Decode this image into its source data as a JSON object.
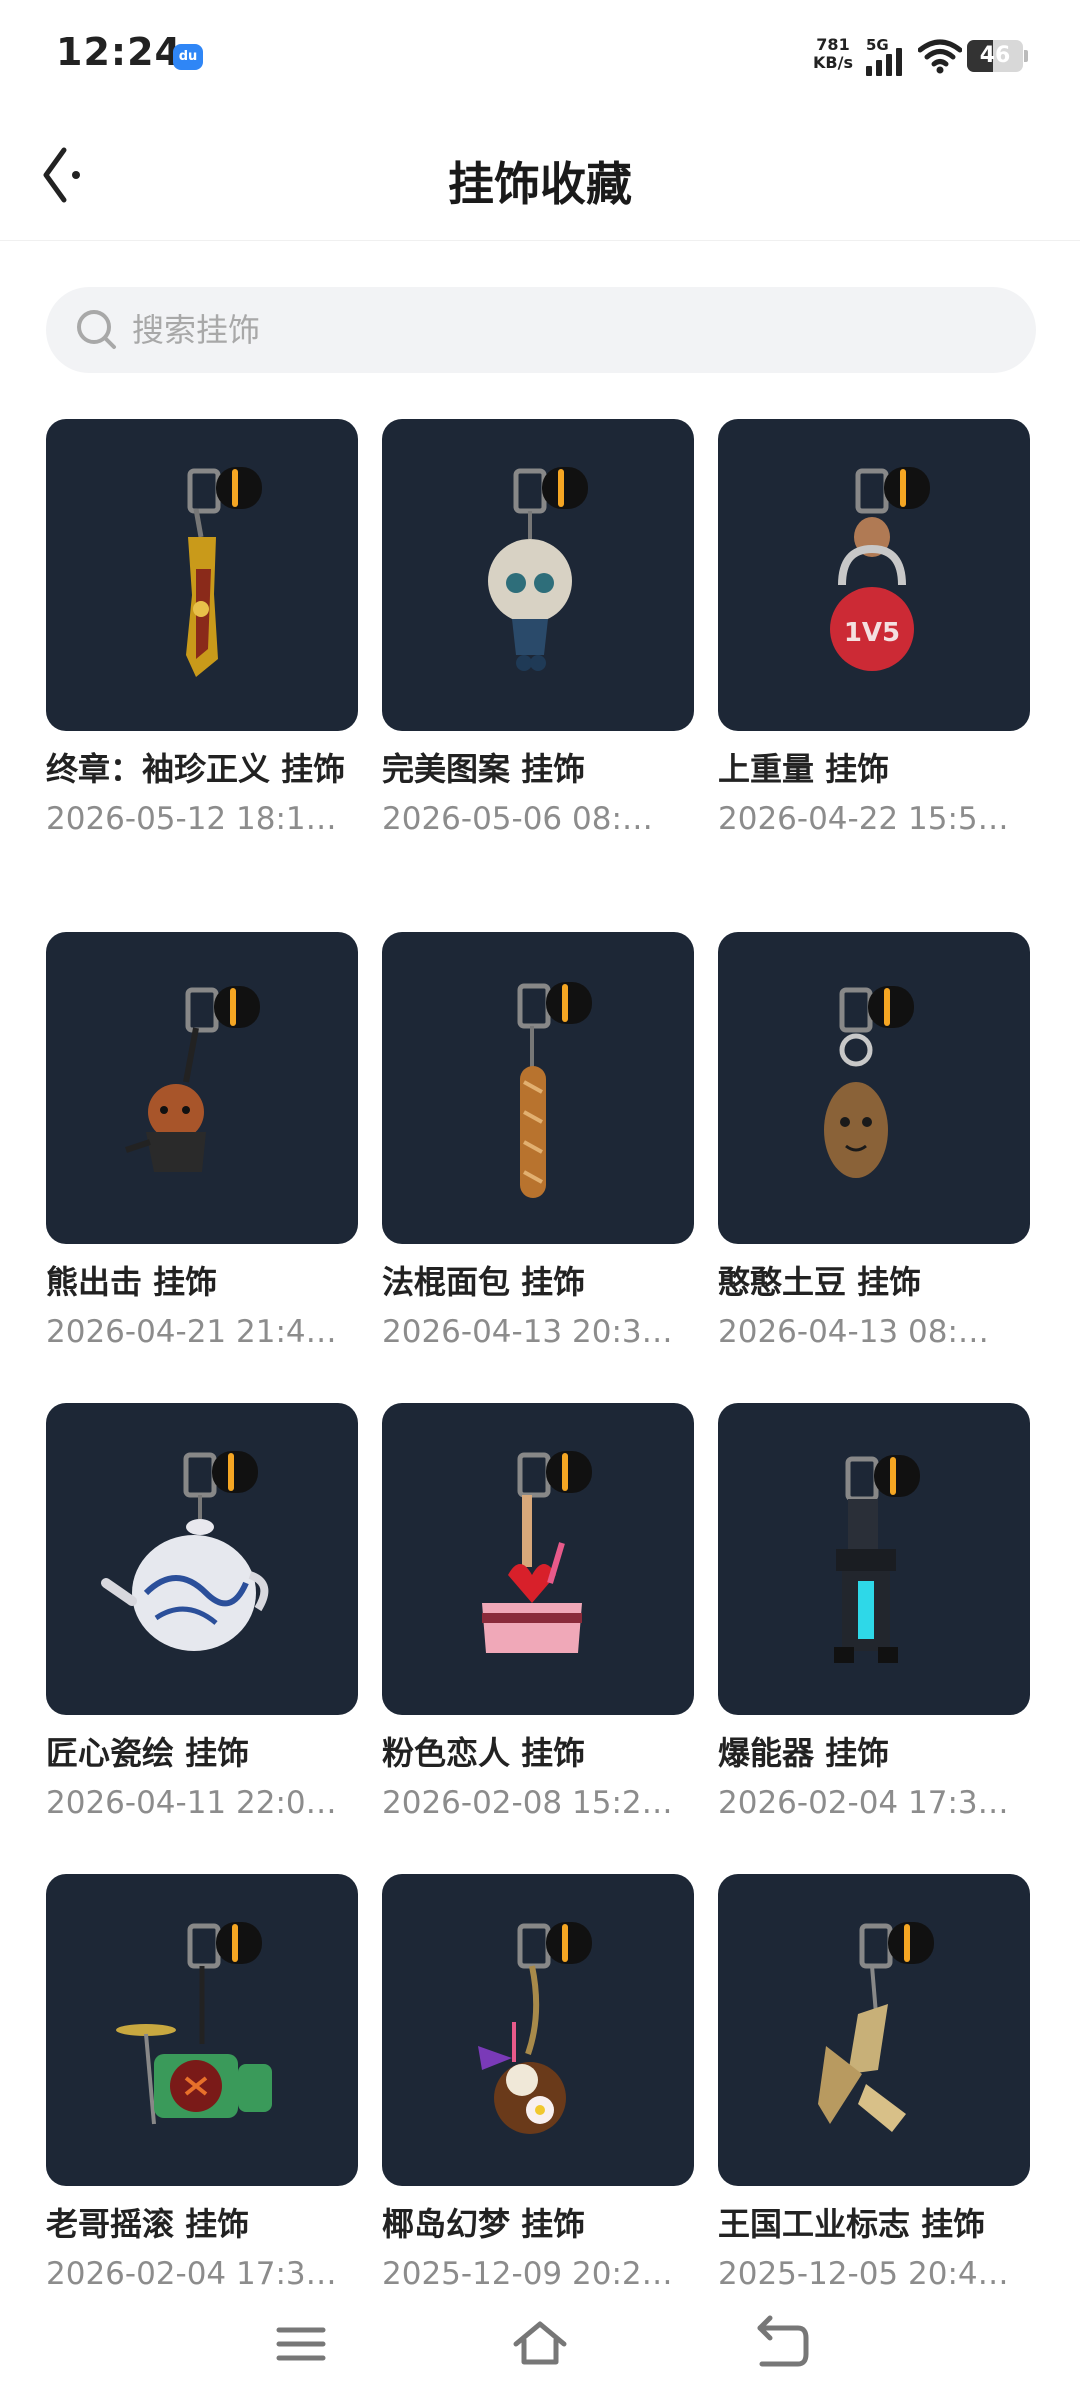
{
  "status_bar": {
    "time": "12:24",
    "notification_icon": "du",
    "net_speed_value": "781",
    "net_speed_unit": "KB/s",
    "network_type": "5G",
    "battery": "46",
    "battery_level": 0.46
  },
  "header": {
    "title": "挂饰收藏",
    "back_icon": "chevron-left-icon"
  },
  "search": {
    "placeholder": "搜索挂饰",
    "value": ""
  },
  "colors": {
    "card_bg": "#1d2736",
    "accent_orange": "#f5a623"
  },
  "items": [
    {
      "name": " 终章：袖珍正义 挂饰",
      "date": "2026-05-12 18:1…",
      "icon": "golden-gun-charm"
    },
    {
      "name": "完美图案 挂饰",
      "date": "2026-05-06 08:…",
      "icon": "doll-charm"
    },
    {
      "name": " 上重量 挂饰",
      "date": "2026-04-22 15:5…",
      "icon": "kettlebell-charm",
      "badge": "1V5"
    },
    {
      "name": "熊出击 挂饰",
      "date": "2026-04-21 21:4…",
      "icon": "bear-charm"
    },
    {
      "name": "法棍面包 挂饰",
      "date": "2026-04-13 20:3…",
      "icon": "baguette-charm"
    },
    {
      "name": "憨憨土豆 挂饰",
      "date": "2026-04-13 08:…",
      "icon": "potato-charm"
    },
    {
      "name": "匠心瓷绘 挂饰",
      "date": "2026-04-11 22:0…",
      "icon": "teapot-charm"
    },
    {
      "name": "粉色恋人 挂饰",
      "date": "2026-02-08 15:2…",
      "icon": "cake-charm"
    },
    {
      "name": "爆能器 挂饰",
      "date": "2026-02-04 17:3…",
      "icon": "blaster-charm"
    },
    {
      "name": "老哥摇滚 挂饰",
      "date": "2026-02-04 17:3…",
      "icon": "drum-kit-charm"
    },
    {
      "name": "椰岛幻梦 挂饰",
      "date": "2025-12-09 20:2…",
      "icon": "coconut-charm"
    },
    {
      "name": "王国工业标志 挂饰",
      "date": "2025-12-05 20:4…",
      "icon": "kingdom-logo-charm"
    }
  ],
  "nav": {
    "menu_icon": "menu-icon",
    "home_icon": "home-icon",
    "back_icon": "back-arrow-icon"
  }
}
